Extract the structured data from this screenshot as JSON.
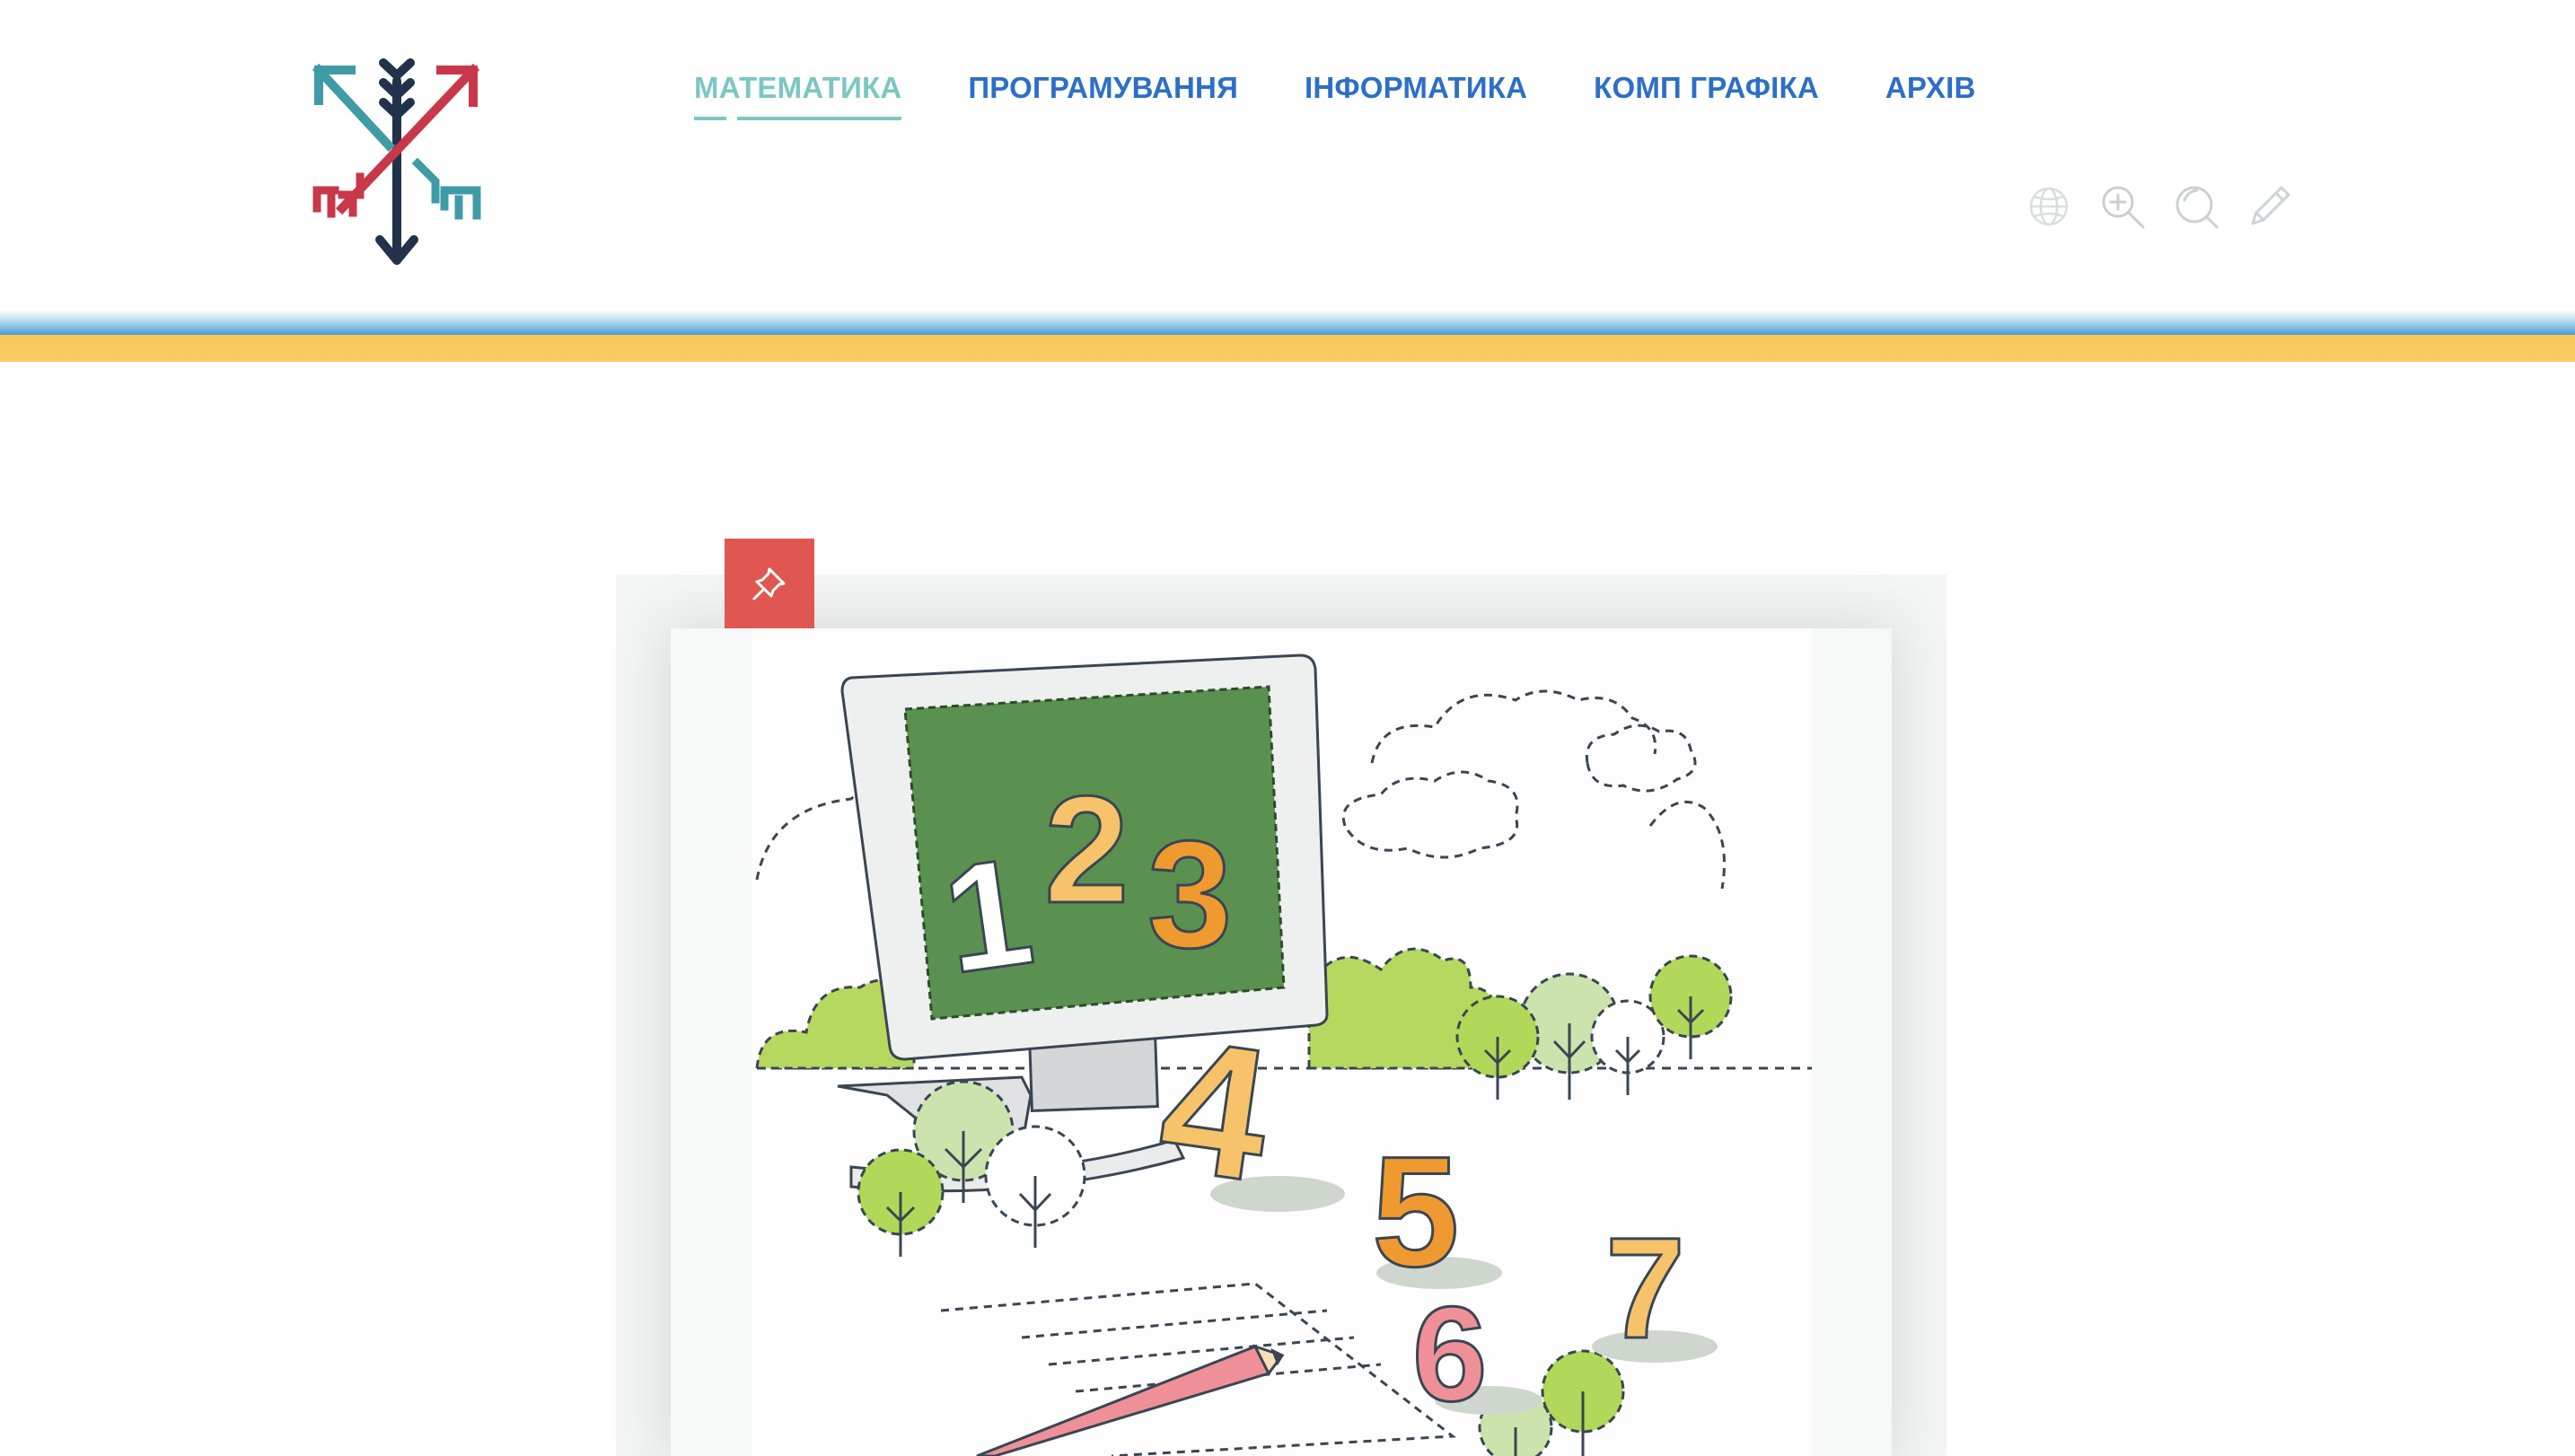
{
  "nav": {
    "items": [
      {
        "label": "МАТЕМАТИКА",
        "active": true
      },
      {
        "label": "ПРОГРАМУВАННЯ",
        "active": false
      },
      {
        "label": "ІНФОРМАТИКА",
        "active": false
      },
      {
        "label": "КОМП ГРАФІКА",
        "active": false
      },
      {
        "label": "АРХІВ",
        "active": false
      }
    ]
  },
  "tools": {
    "icons": [
      "globe-icon",
      "zoom-in-icon",
      "search-icon",
      "pencil-icon"
    ]
  },
  "post": {
    "pin_icon": "pin-icon",
    "image_numbers": [
      "1",
      "2",
      "3",
      "4",
      "5",
      "6",
      "7"
    ]
  },
  "colors": {
    "nav_link": "#2d6fc7",
    "nav_active": "#7cc7c2",
    "band_blue": "#4a9ed6",
    "band_yellow": "#fbcb62",
    "pin_bg": "#e05751"
  }
}
